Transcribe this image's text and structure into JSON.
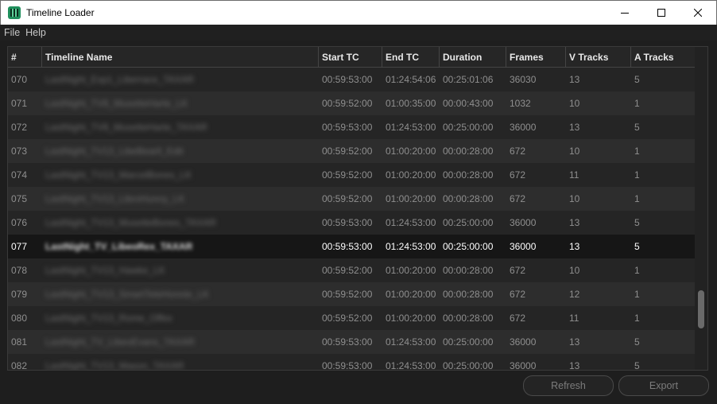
{
  "window": {
    "title": "Timeline Loader"
  },
  "menu": {
    "file": "File",
    "help": "Help"
  },
  "table": {
    "headers": [
      "#",
      "Timeline Name",
      "Start TC",
      "End TC",
      "Duration",
      "Frames",
      "V Tracks",
      "A Tracks"
    ],
    "rows": [
      [
        "070",
        "LastNight_Exp1_Liberrace_TAXAR",
        "00:59:53:00",
        "01:24:54:06",
        "00:25:01:06",
        "36030",
        "13",
        "5"
      ],
      [
        "071",
        "LastNight_TV8_MusetteHarte_LK",
        "00:59:52:00",
        "01:00:35:00",
        "00:00:43:00",
        "1032",
        "10",
        "1"
      ],
      [
        "072",
        "LastNight_TV8_MusetteHarte_TAXAR",
        "00:59:53:00",
        "01:24:53:00",
        "00:25:00:00",
        "36000",
        "13",
        "5"
      ],
      [
        "073",
        "LastNight_TV13_LibeBearll_Edit",
        "00:59:52:00",
        "01:00:20:00",
        "00:00:28:00",
        "672",
        "10",
        "1"
      ],
      [
        "074",
        "LastNight_TV13_MarcelBones_LK",
        "00:59:52:00",
        "01:00:20:00",
        "00:00:28:00",
        "672",
        "11",
        "1"
      ],
      [
        "075",
        "LastNight_TV13_LibroHunny_LK",
        "00:59:52:00",
        "01:00:20:00",
        "00:00:28:00",
        "672",
        "10",
        "1"
      ],
      [
        "076",
        "LastNight_TV13_MusetteBones_TAXAR",
        "00:59:53:00",
        "01:24:53:00",
        "00:25:00:00",
        "36000",
        "13",
        "5"
      ],
      [
        "077",
        "LastNight_TV_LibeoRex_TAXAR",
        "00:59:53:00",
        "01:24:53:00",
        "00:25:00:00",
        "36000",
        "13",
        "5"
      ],
      [
        "078",
        "LastNight_TV13_Hawke_LK",
        "00:59:52:00",
        "01:00:20:00",
        "00:00:28:00",
        "672",
        "10",
        "1"
      ],
      [
        "079",
        "LastNight_TV13_SmartTeleHonnie_LK",
        "00:59:52:00",
        "01:00:20:00",
        "00:00:28:00",
        "672",
        "12",
        "1"
      ],
      [
        "080",
        "LastNight_TV13_Rome_Offex",
        "00:59:52:00",
        "01:00:20:00",
        "00:00:28:00",
        "672",
        "11",
        "1"
      ],
      [
        "081",
        "LastNight_TV_LibeoEvans_TAXAR",
        "00:59:53:00",
        "01:24:53:00",
        "00:25:00:00",
        "36000",
        "13",
        "5"
      ],
      [
        "082",
        "LastNight_TV13_Mason_TAXAR",
        "00:59:53:00",
        "01:24:53:00",
        "00:25:00:00",
        "36000",
        "13",
        "5"
      ]
    ],
    "selected_row": "077"
  },
  "buttons": {
    "refresh": "Refresh",
    "export": "Export"
  }
}
